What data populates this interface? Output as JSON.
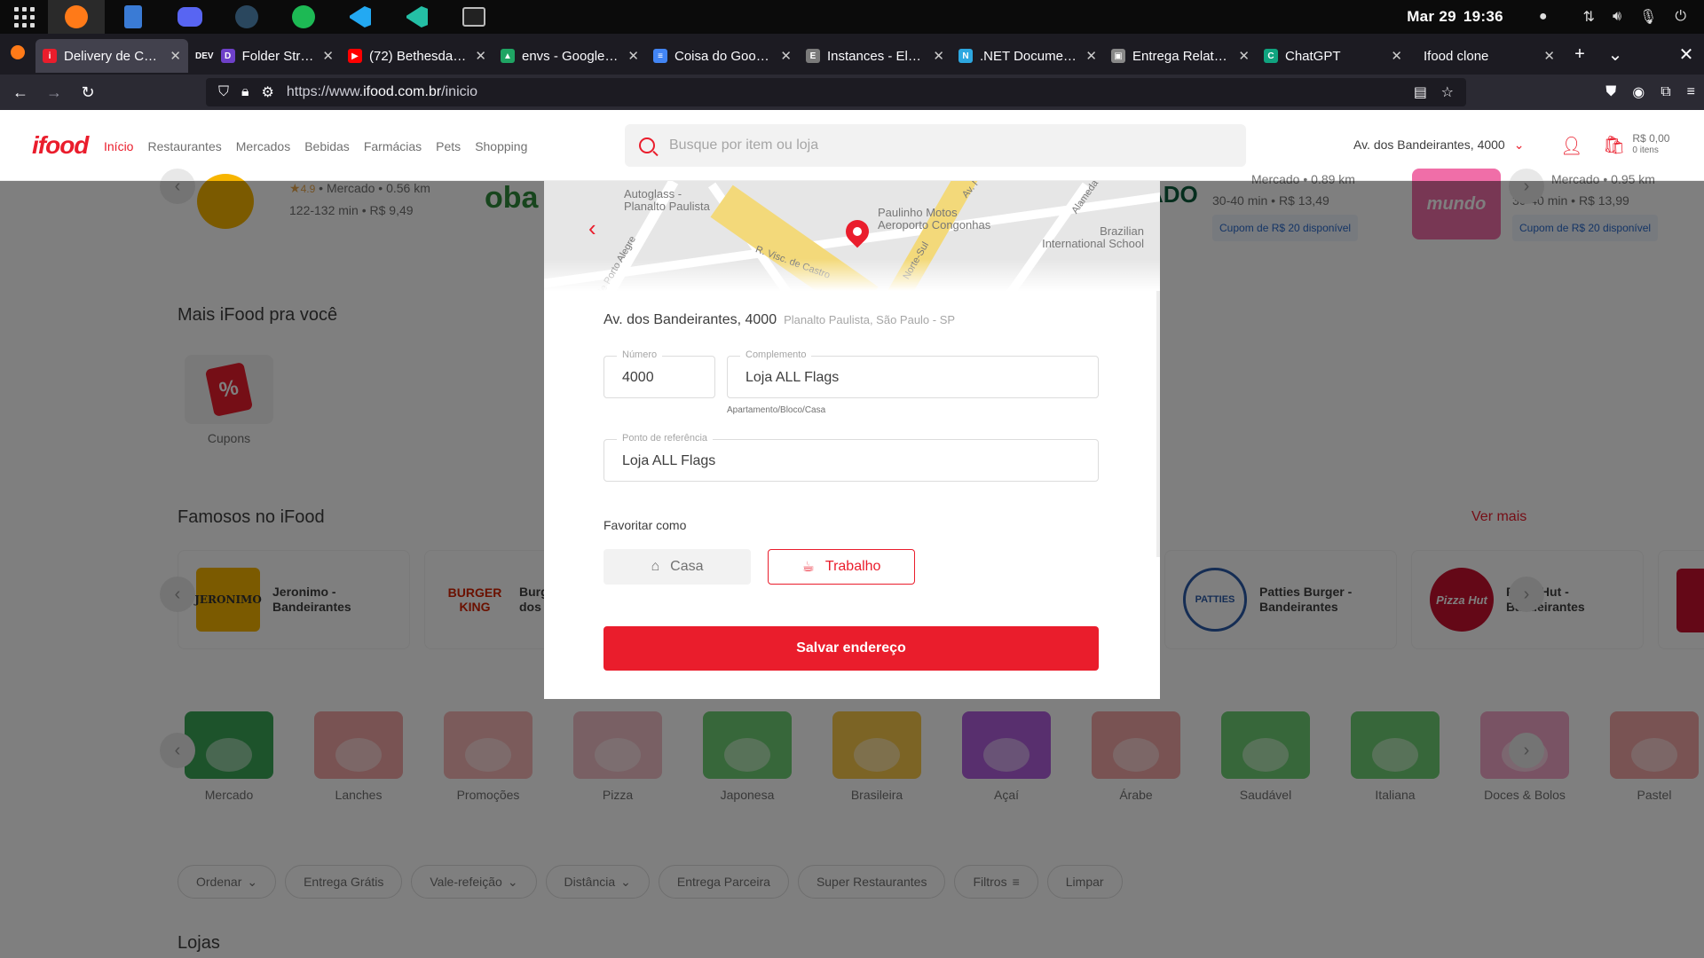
{
  "os": {
    "date": "Mar 29",
    "time": "19:36"
  },
  "tabs": [
    {
      "title": "Delivery de Comida",
      "color": "#ea1d2c",
      "glyph": "i",
      "active": true
    },
    {
      "title": "Folder Structure",
      "color": "#6e40c9",
      "glyph": "D",
      "prefix": "DEV"
    },
    {
      "title": "(72) Bethesda's G",
      "color": "#ff0000",
      "glyph": "▶"
    },
    {
      "title": "envs - Google Drive",
      "color": "#1fa463",
      "glyph": "▲"
    },
    {
      "title": "Coisa do Google",
      "color": "#4285f4",
      "glyph": "≡"
    },
    {
      "title": "Instances - Elephant",
      "color": "#7a7a7a",
      "glyph": "E"
    },
    {
      "title": ".NET Documentation",
      "color": "#2da7e0",
      "glyph": "N"
    },
    {
      "title": "Entrega Relatório",
      "color": "#888888",
      "glyph": "▣"
    },
    {
      "title": "ChatGPT",
      "color": "#10a37f",
      "glyph": "C"
    },
    {
      "title": "Ifood clone",
      "color": "#1c1b22",
      "glyph": ""
    }
  ],
  "browser": {
    "url_prefix": "https://www.",
    "url_domain": "ifood.com.br",
    "url_path": "/inicio"
  },
  "header": {
    "logo": "ifood",
    "nav": [
      "Início",
      "Restaurantes",
      "Mercados",
      "Bebidas",
      "Farmácias",
      "Pets",
      "Shopping"
    ],
    "search_placeholder": "Busque por item ou loja",
    "address": "Av. dos Bandeirantes, 4000",
    "cart_amount": "R$ 0,00",
    "cart_items": "0 itens"
  },
  "merchants_top": [
    {
      "rating": "4.9",
      "type": "Mercado",
      "distance": "0.56 km",
      "time": "122-132 min",
      "fee": "R$ 9,49"
    },
    {
      "time": "30-40 min",
      "fee": "R$ 13,49",
      "coupon": "Cupom de R$ 20 disponível",
      "partial": "Mercado",
      "partial_dist": "0.89 km",
      "brand": "ADO"
    },
    {
      "time": "30-40 min",
      "fee": "R$ 13,99",
      "coupon": "Cupom de R$ 20 disponível",
      "partial": "Mercado",
      "partial_dist": "0.95 km",
      "brand": "mundo"
    }
  ],
  "sections": {
    "mais_ifood": "Mais iFood pra você",
    "cupons": "Cupons",
    "famosos": "Famosos no iFood",
    "ver_mais": "Ver mais",
    "lojas": "Lojas"
  },
  "famous": [
    {
      "name": "Jeronimo - Bandeirantes",
      "logo": "JERONIMO",
      "bg": "#f7b500"
    },
    {
      "name": "Burger King - dos Bandeirantes",
      "logo": "BURGER KING",
      "bg": "#ffffff"
    },
    {
      "name": "Patties Burger - Bandeirantes",
      "logo": "PATTIES",
      "bg": "#ffffff"
    },
    {
      "name": "Pizza Hut - Bandeirantes",
      "logo": "Pizza Hut",
      "bg": "#ffffff"
    }
  ],
  "categories": [
    {
      "label": "Mercado",
      "color": "#3aa757"
    },
    {
      "label": "Lanches",
      "color": "#f2a7a7"
    },
    {
      "label": "Promoções",
      "color": "#f7b6b6"
    },
    {
      "label": "Pizza",
      "color": "#f2c0c8"
    },
    {
      "label": "Japonesa",
      "color": "#6fcf74"
    },
    {
      "label": "Brasileira",
      "color": "#f9c84a"
    },
    {
      "label": "Açaí",
      "color": "#b05fdc"
    },
    {
      "label": "Árabe",
      "color": "#f2a7a7"
    },
    {
      "label": "Saudável",
      "color": "#6fcf74"
    },
    {
      "label": "Italiana",
      "color": "#6fcf74"
    },
    {
      "label": "Doces & Bolos",
      "color": "#f2a7c8"
    },
    {
      "label": "Pastel",
      "color": "#f2a7a7"
    }
  ],
  "filters": [
    {
      "label": "Ordenar",
      "dropdown": true
    },
    {
      "label": "Entrega Grátis"
    },
    {
      "label": "Vale-refeição",
      "dropdown": true
    },
    {
      "label": "Distância",
      "dropdown": true
    },
    {
      "label": "Entrega Parceira"
    },
    {
      "label": "Super Restaurantes"
    },
    {
      "label": "Filtros",
      "icon": true
    },
    {
      "label": "Limpar"
    }
  ],
  "modal": {
    "map_labels": [
      "Autoglass - Planalto Paulista",
      "Paulinho Motos",
      "Aeroporto Congonhas",
      "Brazilian International School",
      "de Porto Alegre",
      "R. Visc. de Castro",
      "Alameda",
      "Norte-Sul",
      "Av. Moreira Guimarães"
    ],
    "address_main": "Av. dos Bandeirantes, 4000",
    "address_sub": "Planalto Paulista, São Paulo - SP",
    "numero_label": "Número",
    "numero_value": "4000",
    "complemento_label": "Complemento",
    "complemento_value": "Loja ALL Flags",
    "complemento_hint": "Apartamento/Bloco/Casa",
    "referencia_label": "Ponto de referência",
    "referencia_value": "Loja ALL Flags",
    "favoritar_label": "Favoritar como",
    "casa_label": "Casa",
    "trabalho_label": "Trabalho",
    "save_label": "Salvar endereço"
  }
}
